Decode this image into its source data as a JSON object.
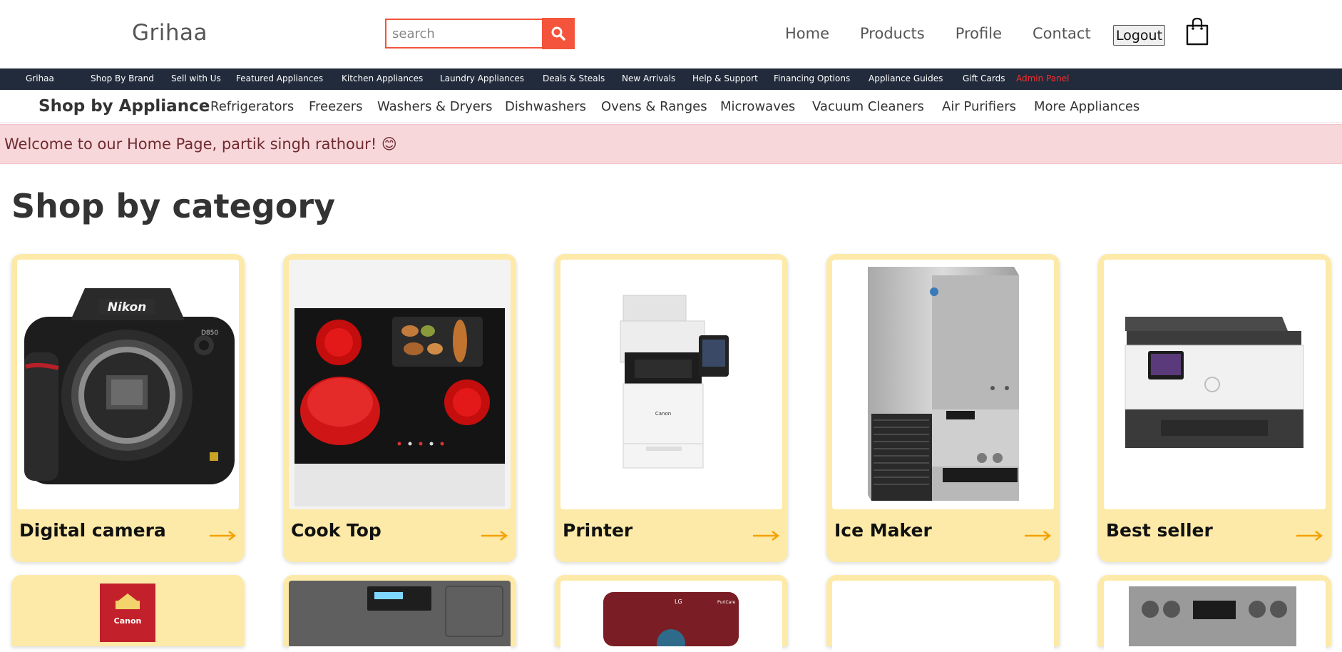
{
  "header": {
    "brand": "Grihaa",
    "search": {
      "placeholder": "search",
      "value": ""
    },
    "nav": [
      "Home",
      "Products",
      "Profile",
      "Contact"
    ],
    "logout_label": "Logout"
  },
  "subnav": {
    "items": [
      "Grihaa",
      "Shop By Brand",
      "Sell with Us",
      "Featured Appliances",
      "Kitchen Appliances",
      "Laundry Appliances",
      "Deals & Steals",
      "New Arrivals",
      "Help & Support",
      "Financing Options",
      "Appliance Guides",
      "Gift Cards"
    ],
    "admin_label": "Admin Panel"
  },
  "appliance_bar": {
    "title": "Shop by Appliance",
    "items": [
      "Refrigerators",
      "Freezers",
      "Washers & Dryers",
      "Dishwashers",
      "Ovens & Ranges",
      "Microwaves",
      "Vacuum Cleaners",
      "Air Purifiers",
      "More Appliances"
    ]
  },
  "welcome": {
    "text": "Welcome to our Home Page, partik singh rathour! 😊"
  },
  "categories": {
    "title": "Shop by category",
    "cards": [
      {
        "label": "Digital camera",
        "icon": "camera-image"
      },
      {
        "label": "Cook Top",
        "icon": "cooktop-image"
      },
      {
        "label": "Printer",
        "icon": "printer-image"
      },
      {
        "label": "Ice Maker",
        "icon": "ice-maker-image"
      },
      {
        "label": "Best seller",
        "icon": "hp-printer-image"
      }
    ]
  },
  "colors": {
    "accent": "#f4543b",
    "subnav_bg": "#222b3b",
    "card_bg": "#fdeaa8",
    "arrow": "#f5a000",
    "welcome_bg": "#f8d7da",
    "admin": "#ff2b2b"
  }
}
